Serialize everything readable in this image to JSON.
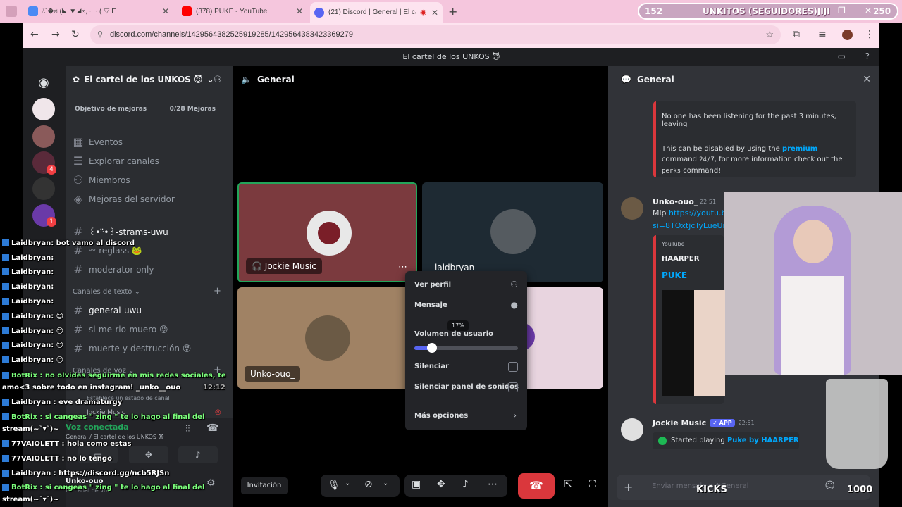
{
  "browser": {
    "tabs": [
      {
        "label": "ඩ�ಠ (◣ ▼◢ಠ,~ ~ ( ▽ E",
        "color": "#4a8af4"
      },
      {
        "label": "(378) PUKE - YouTube",
        "color": "#ff0000"
      },
      {
        "label": "(21) Discord | General | El ca",
        "color": "#5865f2"
      }
    ],
    "new_tab": "+",
    "url": "discord.com/channels/1429564382525919285/1429564383423369279"
  },
  "overlay_top": {
    "left_count": "152",
    "title": "UNKITOS (SEGUIDORES)JIJI",
    "right_count": "250"
  },
  "window_title": "El cartel de los UNKOS 😈",
  "server": {
    "name": "El cartel de los UNKOS 😈",
    "goal_label": "Objetivo de mejoras",
    "goal_value": "0/28 Mejoras",
    "menu": [
      "Eventos",
      "Explorar canales",
      "Miembros",
      "Mejoras del servidor"
    ],
    "channels_top": [
      "꒰•ᵕ̈•꒱-strams-uwu",
      "ᵕᵕ-reglass 🐸",
      "moderator-only"
    ],
    "text_category": "Canales de texto",
    "text_channels": [
      "general-uwu",
      "si-me-rio-muero 😝",
      "muerte-y-destrucción 😵"
    ],
    "voice_category": "Canales de voz",
    "channel_status_hint": "Establece un estado de canal",
    "user_name": "Jockie Music",
    "voice_connected": "Voz conectada",
    "voice_location": "General / El cartel de los UNKOS 😈",
    "self_name": "Unko-ouo",
    "self_status": "En canal de voz"
  },
  "guild_badges": {
    "g4": "4",
    "g7": "1"
  },
  "voice": {
    "channel_name": "General",
    "tiles": [
      {
        "name": "Jockie Music"
      },
      {
        "name": "laidbryan"
      },
      {
        "name": "Unko-ouo_"
      }
    ],
    "invite_label": "Invitación"
  },
  "context_menu": {
    "view_profile": "Ver perfil",
    "message": "Mensaje",
    "volume_label": "Volumen de usuario",
    "volume_pct": "17%",
    "volume_level": 0.17,
    "mute": "Silenciar",
    "mute_soundboard": "Silenciar panel de sonidos",
    "more": "Más opciones"
  },
  "chat_panel": {
    "title": "General",
    "bot_msg_line1": "No one has been listening for the past 3 minutes, leaving",
    "bot_msg_line2a": "This can be disabled by using the",
    "bot_msg_premium": "premium",
    "bot_msg_line2b": "command",
    "bot_msg_cmd": "24/7",
    "bot_msg_line3": ", for more information check out the",
    "bot_msg_perks": "perks",
    "bot_msg_line4": "command!",
    "msg1_author": "Unko-ouo_",
    "msg1_time": "22:51",
    "msg1_link": "https://youtu.b",
    "msg1_link2": "si=8TOxtjcTyLueUr",
    "embed_provider": "YouTube",
    "embed_author": "HAARPER",
    "embed_title": "PUKE",
    "msg2_author": "Jockie Music",
    "msg2_badge": "✓ APP",
    "msg2_time": "22:51",
    "msg2_text_a": "Started playing",
    "msg2_text_b": "Puke by HAARPER",
    "input_placeholder": "Enviar mensaje a #General"
  },
  "stream_chat": [
    {
      "user": "Laidbryan",
      "text": ": bot vamo al discord"
    },
    {
      "user": "Laidbryan",
      "text": ":"
    },
    {
      "user": "Laidbryan",
      "text": ":"
    },
    {
      "user": "Laidbryan",
      "text": ":"
    },
    {
      "user": "Laidbryan",
      "text": ":"
    },
    {
      "user": "Laidbryan",
      "text": ": 😊"
    },
    {
      "user": "Laidbryan",
      "text": ": 😊"
    },
    {
      "user": "Laidbryan",
      "text": ": 😊"
    },
    {
      "user": "Laidbryan",
      "text": ": 😊"
    }
  ],
  "stream_chat2": {
    "l1": "BotRix : no olvides seguirme en mis redes sociales, te",
    "l2": "amo<3 sobre todo en instagram! _unko__ouo",
    "l2_time": "12:12",
    "l3": "Laidbryan : eve dramaturgy",
    "l4": "BotRix : si cangeas \" zing \" te lo hago al final del",
    "l5": "stream(~˘▾˘)~",
    "l6": "77VAIOLETT : hola como estas",
    "l7": "77VAIOLETT : no lo tengo",
    "l8": "Laidbryan : https://discord.gg/ncb5RJSn",
    "l9": "BotRix : si cangeas \" zing \" te lo hago al final del",
    "l10": "stream(~˘▾˘)~"
  },
  "overlay_bottom": {
    "kicks": "KICKS",
    "count": "1000"
  }
}
